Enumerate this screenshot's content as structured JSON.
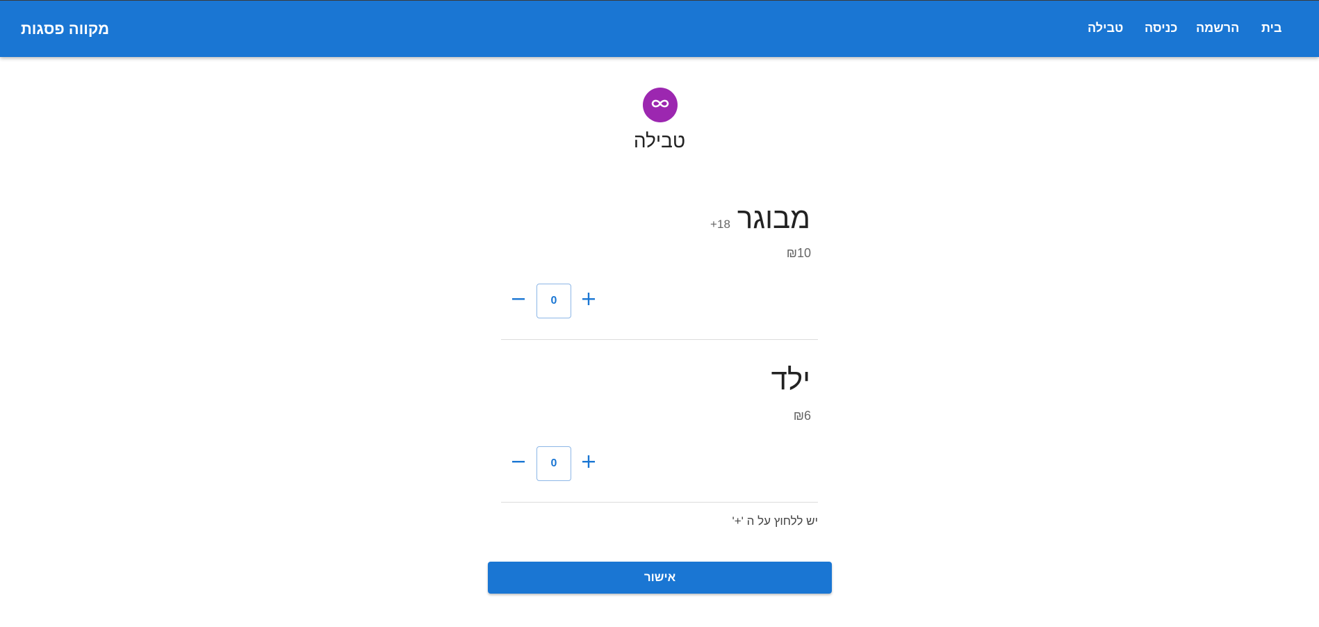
{
  "header": {
    "brand": "מקווה פסגות",
    "nav": [
      {
        "label": "בית"
      },
      {
        "label": "הרשמה"
      },
      {
        "label": "כניסה"
      },
      {
        "label": "טבילה"
      }
    ],
    "color": "#1a76d3"
  },
  "page": {
    "icon": "infinity-icon",
    "title": "טבילה"
  },
  "items": [
    {
      "name": "מבוגר",
      "note": "18+",
      "price": "₪10",
      "quantity": "0"
    },
    {
      "name": "ילד",
      "note": "",
      "price": "₪6",
      "quantity": "0"
    }
  ],
  "hint": "יש ללחוץ על ה '+'",
  "confirm_label": "אישור",
  "colors": {
    "accent": "#1a76d3",
    "avatar": "#9c27b0"
  }
}
